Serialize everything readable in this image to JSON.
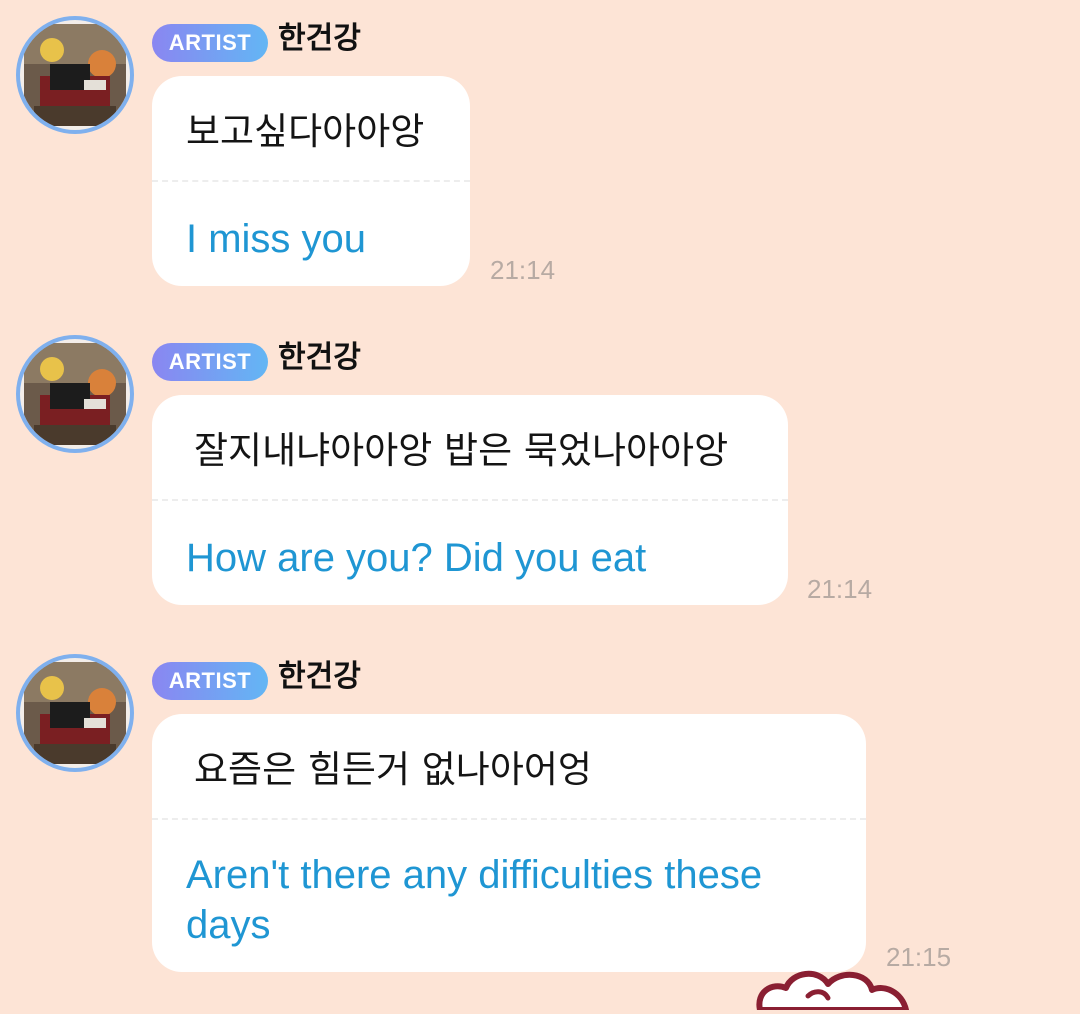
{
  "messages": [
    {
      "badge": "ARTIST",
      "sender": "한건강",
      "original": "보고싶다아아앙",
      "translation": "I miss you",
      "time": "21:14"
    },
    {
      "badge": "ARTIST",
      "sender": "한건강",
      "original": "잘지내냐아아앙 밥은 묵었나아아앙",
      "translation": "How are you? Did you eat",
      "time": "21:14"
    },
    {
      "badge": "ARTIST",
      "sender": "한건강",
      "original": "요즘은 힘든거 없나아어엉",
      "translation": "Aren't there any difficulties these days",
      "time": "21:15"
    }
  ],
  "colors": {
    "background": "#fde4d6",
    "bubble": "#ffffff",
    "translation_text": "#1f96d3",
    "badge_gradient_start": "#8a86f1",
    "badge_gradient_end": "#63b6f4",
    "avatar_ring": "#7fb0ee",
    "timestamp": "#b7aaa3"
  },
  "icons": {
    "avatar": "artist-avatar-photo",
    "sticker": "cloud-sticker-icon"
  }
}
